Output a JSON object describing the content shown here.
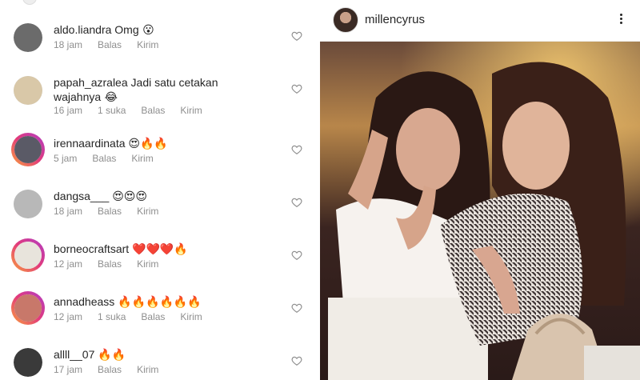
{
  "comments": [
    {
      "username": "aldo.liandra",
      "text": "Omg",
      "emoji": "😮",
      "time": "18 jam",
      "likes": "",
      "reply": "Balas",
      "send": "Kirim",
      "story_ring": false,
      "avatar_color": "#6b6b6b"
    },
    {
      "username": "papah_azralea",
      "text": "Jadi satu cetakan wajahnya",
      "emoji": "😂",
      "time": "16 jam",
      "likes": "1 suka",
      "reply": "Balas",
      "send": "Kirim",
      "story_ring": false,
      "avatar_color": "#d9c8a8"
    },
    {
      "username": "irennaardinata",
      "text": "",
      "emoji": "😍🔥🔥",
      "time": "5 jam",
      "likes": "",
      "reply": "Balas",
      "send": "Kirim",
      "story_ring": true,
      "avatar_color": "#5a5a66"
    },
    {
      "username": "dangsa___",
      "text": "",
      "emoji": "😍😍😍",
      "time": "18 jam",
      "likes": "",
      "reply": "Balas",
      "send": "Kirim",
      "story_ring": false,
      "avatar_color": "#b8b8b8"
    },
    {
      "username": "borneocraftsart",
      "text": "",
      "emoji": "❤️❤️❤️🔥",
      "time": "12 jam",
      "likes": "",
      "reply": "Balas",
      "send": "Kirim",
      "story_ring": true,
      "avatar_color": "#e8e4dc"
    },
    {
      "username": "annadheass",
      "text": "",
      "emoji": "🔥🔥🔥🔥🔥🔥",
      "time": "12 jam",
      "likes": "1 suka",
      "reply": "Balas",
      "send": "Kirim",
      "story_ring": true,
      "avatar_color": "#c8786a"
    },
    {
      "username": "allll__07",
      "text": "",
      "emoji": "🔥🔥",
      "time": "17 jam",
      "likes": "",
      "reply": "Balas",
      "send": "Kirim",
      "story_ring": false,
      "avatar_color": "#3a3a3a"
    }
  ],
  "post": {
    "username": "millencyrus",
    "more_icon": "more-vertical-icon",
    "photo_colors": {
      "top": "#d8b070",
      "mid": "#4a2a22",
      "bottom": "#f4efe8"
    }
  },
  "colors": {
    "text": "#262626",
    "meta": "#8e8e8e",
    "story_ring": [
      "#f9a23b",
      "#e33b7a",
      "#b03cc6"
    ]
  }
}
